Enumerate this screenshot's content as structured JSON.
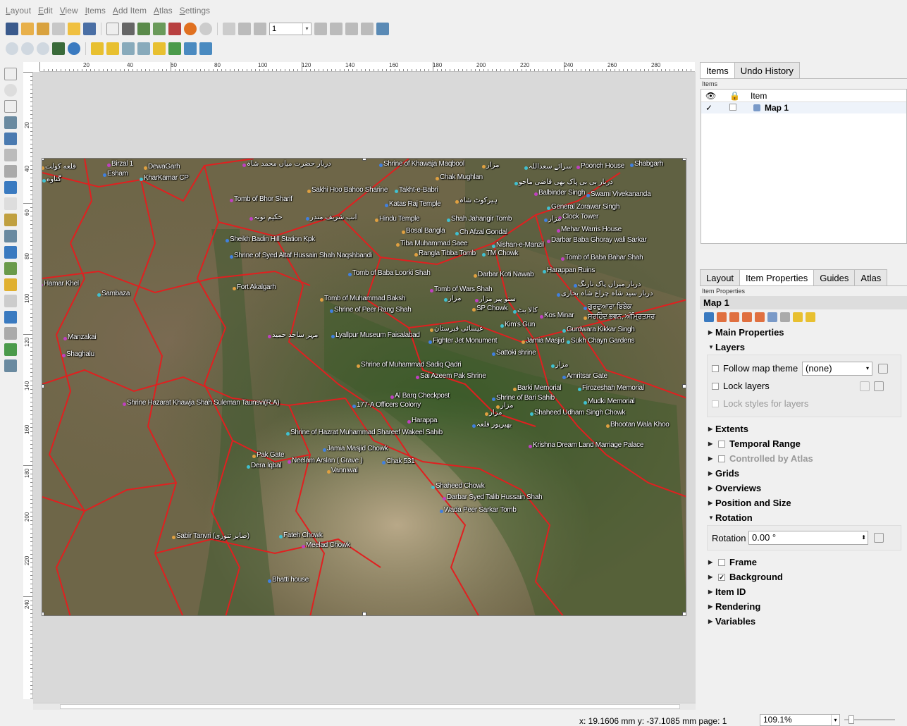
{
  "menu": [
    "Layout",
    "Edit",
    "View",
    "Items",
    "Add Item",
    "Atlas",
    "Settings"
  ],
  "toolbar": {
    "page_value": "1"
  },
  "hruler": [
    "20",
    "40",
    "60",
    "80",
    "100",
    "120",
    "140",
    "160",
    "180",
    "200",
    "220",
    "240",
    "260",
    "280"
  ],
  "vruler": [
    "20",
    "40",
    "60",
    "80",
    "100",
    "120",
    "140",
    "160",
    "180",
    "200",
    "220",
    "240"
  ],
  "map_labels": [
    [
      "قلعه کولت",
      4,
      6
    ],
    [
      "گناوه",
      6,
      24
    ],
    [
      "Birzal 1",
      98,
      2
    ],
    [
      "Esham",
      92,
      16
    ],
    [
      "DewaGarh",
      150,
      6
    ],
    [
      "KharKamar CP",
      144,
      22
    ],
    [
      "دربار حضرت میاں محمد شاہ",
      290,
      2
    ],
    [
      "Shrine of Khawaja Maqbool",
      484,
      2
    ],
    [
      "مزار",
      630,
      4
    ],
    [
      "سرائے سعداللہ",
      690,
      6
    ],
    [
      "Poonch House",
      764,
      5
    ],
    [
      "Shabgarh",
      840,
      2
    ],
    [
      "Chak Mughlan",
      564,
      21
    ],
    [
      "دربار بی بی پاک بھی قاضی ماجو",
      676,
      28
    ],
    [
      "Balbinder Singh",
      704,
      43
    ],
    [
      "Swami Vivekananda",
      778,
      45
    ],
    [
      "Sakhi Hoo Bahoo Sharine",
      382,
      39
    ],
    [
      "Takht-e-Babri",
      506,
      39
    ],
    [
      "Tomb of Bhor Sharif",
      272,
      52
    ],
    [
      "Katas Raj Temple",
      492,
      59
    ],
    [
      "ہیرکوٹ شاہ",
      592,
      54
    ],
    [
      "General Zorawar Singh",
      722,
      63
    ],
    [
      "حکیم توبہ",
      300,
      78
    ],
    [
      "انب شریف مندر",
      380,
      78
    ],
    [
      "Hindu Temple",
      478,
      80
    ],
    [
      "Shah Jahangir Tomb",
      580,
      80
    ],
    [
      "Clock Tower",
      738,
      77
    ],
    [
      "مزار",
      718,
      80
    ],
    [
      "Bosal Bangla",
      516,
      97
    ],
    [
      "Ch Afzal Gondal",
      592,
      99
    ],
    [
      "Mehar Warris House",
      736,
      95
    ],
    [
      "Sheikh Badin Hill Station Kpk",
      266,
      109
    ],
    [
      "Tiba Muhammad Saee",
      508,
      115
    ],
    [
      "Nishan-e-Manzil",
      644,
      117
    ],
    [
      "Darbar Baba Ghoray wali Sarkar",
      722,
      110
    ],
    [
      "Shrine of Syed Altaf Hussain Shah Naqshbandi",
      272,
      132
    ],
    [
      "Rangla Tibba Tomb",
      534,
      129
    ],
    [
      "TM Chowk",
      630,
      129
    ],
    [
      "Tomb of Baba Bahar Shah",
      742,
      135
    ],
    [
      "Tomb of Baba Loorki Shah",
      440,
      157
    ],
    [
      "Darbar Koti Nawab",
      618,
      159
    ],
    [
      "Harappan Ruins",
      716,
      153
    ],
    [
      "Hamar Khel",
      2,
      172
    ],
    [
      "دربار میراں پاک نارنگ",
      760,
      173
    ],
    [
      "Fort Akalgarh",
      276,
      177
    ],
    [
      "Sambaza",
      84,
      186
    ],
    [
      "Tomb of Wars Shah",
      556,
      180
    ],
    [
      "دربار سید شاہ چراغ شاہ بخاری",
      736,
      186
    ],
    [
      "Tomb of Muhammad Baksh",
      400,
      193
    ],
    [
      "مزار",
      576,
      193
    ],
    [
      "سنو پیر مزار",
      620,
      194
    ],
    [
      "Shrine of Peer Rang Shah",
      414,
      209
    ],
    [
      "SP Chowk",
      616,
      207
    ],
    [
      "کالا بٹ",
      674,
      210
    ],
    [
      "Kos Minar",
      712,
      217
    ],
    [
      "ਗੁਰਦੁਆਰਾ ਬਿਬੇਕ",
      774,
      205
    ],
    [
      "ਸਰਹਿੰਦ ਭਵਨ, ਅੰਮ੍ਰਿਤਸਰ",
      774,
      219
    ],
    [
      "Kim's Gun",
      656,
      230
    ],
    [
      "مہر ساجد حمید",
      326,
      245
    ],
    [
      "Lyallpur Museum Faisalabad",
      416,
      245
    ],
    [
      "عیسائی قبرستان",
      556,
      236
    ],
    [
      "Gurdwara Kikkar Singh",
      744,
      237
    ],
    [
      "Manzakai",
      36,
      248
    ],
    [
      "Fighter Jet Monument",
      554,
      253
    ],
    [
      "Jamia Masjid",
      686,
      253
    ],
    [
      "Sukh Chayn Gardens",
      750,
      253
    ],
    [
      "Shaghalu",
      34,
      272
    ],
    [
      "Sattoki shrine",
      644,
      270
    ],
    [
      "Shrine of Muhammad Sadiq Qadri",
      452,
      287
    ],
    [
      "مزار",
      728,
      287
    ],
    [
      "Sai Azeem Pak Shrine",
      536,
      303
    ],
    [
      "Amritsar Gate",
      744,
      303
    ],
    [
      "Barki Memorial",
      674,
      320
    ],
    [
      "Firozeshah Memorial",
      766,
      320
    ],
    [
      "Al Barq Checkpost",
      500,
      331
    ],
    [
      "Shrine of Bari Sahib",
      644,
      334
    ],
    [
      "مزار",
      650,
      345
    ],
    [
      "Mudki Memorial",
      774,
      339
    ],
    [
      "Shrine Hazarat Khawja Shah Suleman Taunsvi(R.A)",
      120,
      341
    ],
    [
      "177-A Officers Colony",
      446,
      344
    ],
    [
      "مزار",
      634,
      355
    ],
    [
      "Shaheed Udham Singh Chowk",
      698,
      355
    ],
    [
      "Harappa",
      524,
      366
    ],
    [
      "بھیرپور قلعہ",
      616,
      372
    ],
    [
      "Bhootan Wala Khoo",
      806,
      372
    ],
    [
      "Shrine of Hazrat Muhammad Shareef Wakeel Sahib",
      352,
      383
    ],
    [
      "Krishna Dream Land Marriage Palace",
      696,
      401
    ],
    [
      "Jamia Masjid Chowk",
      404,
      406
    ],
    [
      "Pak Gate",
      304,
      415
    ],
    [
      "Dera Iqbal",
      296,
      430
    ],
    [
      "Neelam Arslan ( Grave )",
      354,
      423
    ],
    [
      "Chak 531",
      488,
      424
    ],
    [
      "Vanniwal",
      410,
      437
    ],
    [
      "Shaheed Chowk",
      558,
      459
    ],
    [
      "Darbar Syed Talib Hussain Shah",
      574,
      475
    ],
    [
      "Wada Peer Sarkar Tomb",
      570,
      493
    ],
    [
      "Sabir Tanvri (صابر تنوری)",
      190,
      530
    ],
    [
      "Fateh Chowk",
      342,
      529
    ],
    [
      "Meelad Chowk",
      374,
      543
    ],
    [
      "Bhatti house",
      326,
      592
    ]
  ],
  "right_tabs_top": [
    "Items",
    "Undo History"
  ],
  "items_panel_title": "Items",
  "items_col": "Item",
  "items_rows": [
    {
      "name": "Map 1",
      "visible": "✓"
    }
  ],
  "right_tabs_bottom": [
    "Layout",
    "Item Properties",
    "Guides",
    "Atlas"
  ],
  "props_panel_title": "Item Properties",
  "item_name": "Map 1",
  "sections_a": [
    "Main Properties",
    "Layers"
  ],
  "layers": {
    "follow": "Follow map theme",
    "theme": "(none)",
    "lock": "Lock layers",
    "lock_styles": "Lock styles for layers"
  },
  "sections_b": [
    {
      "label": "Extents",
      "cb": false
    },
    {
      "label": "Temporal Range",
      "cb": true
    },
    {
      "label": "Controlled by Atlas",
      "cb": true,
      "disabled": true
    },
    {
      "label": "Grids",
      "cb": false
    },
    {
      "label": "Overviews",
      "cb": false
    },
    {
      "label": "Position and Size",
      "cb": false
    },
    {
      "label": "Rotation",
      "cb": false,
      "open": true
    }
  ],
  "rotation": {
    "label": "Rotation",
    "value": "0.00 °"
  },
  "sections_c": [
    {
      "label": "Frame",
      "cb": true,
      "checked": false
    },
    {
      "label": "Background",
      "cb": true,
      "checked": true
    },
    {
      "label": "Item ID"
    },
    {
      "label": "Rendering"
    },
    {
      "label": "Variables"
    }
  ],
  "status": {
    "coords": "x: 19.1606 mm y: -37.1085 mm page: 1",
    "zoom": "109.1%"
  }
}
